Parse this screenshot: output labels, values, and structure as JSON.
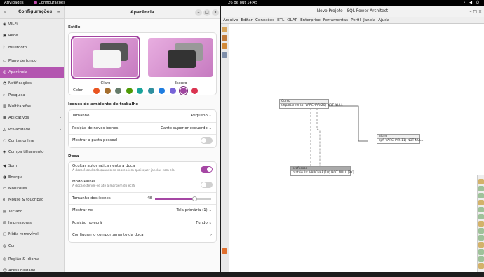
{
  "topbar": {
    "activities": "Atividades",
    "app": "Configurações",
    "clock": "26 de out  14:45",
    "tray": "ꞏ ◀ ⏻"
  },
  "settings": {
    "title": "Configurações",
    "sidebar": [
      {
        "icon": "wifi-icon",
        "glyph": "◉",
        "label": "Wi-Fi"
      },
      {
        "icon": "network-icon",
        "glyph": "▣",
        "label": "Rede"
      },
      {
        "icon": "bluetooth-icon",
        "glyph": "ᛒ",
        "label": "Bluetooth"
      },
      {
        "icon": "background-icon",
        "glyph": "▭",
        "label": "Plano de fundo",
        "sep": true
      },
      {
        "icon": "appearance-icon",
        "glyph": "◐",
        "label": "Aparência",
        "selected": true
      },
      {
        "icon": "notifications-icon",
        "glyph": "◔",
        "label": "Notificações"
      },
      {
        "icon": "search-icon",
        "glyph": "⌕",
        "label": "Pesquisa"
      },
      {
        "icon": "multitasking-icon",
        "glyph": "▥",
        "label": "Multitarefas"
      },
      {
        "icon": "applications-icon",
        "glyph": "▦",
        "label": "Aplicativos",
        "chevron": true
      },
      {
        "icon": "privacy-icon",
        "glyph": "◭",
        "label": "Privacidade",
        "chevron": true
      },
      {
        "icon": "online-accounts-icon",
        "glyph": "◌",
        "label": "Contas online"
      },
      {
        "icon": "sharing-icon",
        "glyph": "◈",
        "label": "Compartilhamento"
      },
      {
        "icon": "sound-icon",
        "glyph": "◀",
        "label": "Som",
        "sep": true
      },
      {
        "icon": "power-icon",
        "glyph": "◑",
        "label": "Energia"
      },
      {
        "icon": "displays-icon",
        "glyph": "▭",
        "label": "Monitores"
      },
      {
        "icon": "mouse-icon",
        "glyph": "◖",
        "label": "Mouse & touchpad"
      },
      {
        "icon": "keyboard-icon",
        "glyph": "▤",
        "label": "Teclado"
      },
      {
        "icon": "printers-icon",
        "glyph": "▧",
        "label": "Impressoras"
      },
      {
        "icon": "removable-media-icon",
        "glyph": "▢",
        "label": "Mídia removível"
      },
      {
        "icon": "color-icon",
        "glyph": "◍",
        "label": "Cor"
      },
      {
        "icon": "region-icon",
        "glyph": "◎",
        "label": "Região & idioma",
        "sep": true
      },
      {
        "icon": "accessibility-icon",
        "glyph": "☺",
        "label": "Acessibilidade"
      }
    ],
    "page_title": "Aparência",
    "style_section": "Estilo",
    "style_light": "Claro",
    "style_dark": "Escuro",
    "color_label": "Color",
    "colors": [
      "#e95420",
      "#a56e2e",
      "#657b69",
      "#4e9a06",
      "#18a39a",
      "#2f8f9f",
      "#1f7de0",
      "#7764d8",
      "#a046a0",
      "#da3450"
    ],
    "active_color": 8,
    "desktop_icons_section": "Ícones do ambiente de trabalho",
    "size_label": "Tamanho",
    "size_value": "Pequeno",
    "new_icons_label": "Posição de novos ícones",
    "new_icons_value": "Canto superior esquerdo",
    "show_home_label": "Mostrar a pasta pessoal",
    "dock_section": "Doca",
    "autohide_label": "Ocultar automaticamente a doca",
    "autohide_sub": "A doca é ocultada quando se sobrepõem quaisquer janelas com ela.",
    "panel_label": "Modo Painel",
    "panel_sub": "A doca estende-se até a margem do ecrã.",
    "icon_size_label": "Tamanho dos ícones",
    "icon_size_value": "48",
    "icon_size_fraction": 0.7,
    "show_on_label": "Mostrar no",
    "show_on_value": "Tela primária (1)",
    "position_label": "Posição no ecrã",
    "position_value": "Fundo",
    "configure_label": "Configurar o comportamento da doca"
  },
  "architect": {
    "title": "Novo Projeto - SQL Power Architect",
    "menu": [
      "Arquivo",
      "Editar",
      "Conexões",
      "ETL",
      "OLAP",
      "Enterprise",
      "Ferramentas",
      "Perfil",
      "Janela",
      "Ajuda"
    ],
    "tables": {
      "curso": {
        "name": "Curso",
        "column": "departamento: VARCHAR(20)   NOT NULL"
      },
      "aluno": {
        "name": "aluno",
        "column": "cpf: VARCHAR(11)   NOT NULL"
      },
      "professor": {
        "name": "professor",
        "column": "matricula: VARCHAR(10)   NOT NULL  [PK]"
      }
    }
  }
}
